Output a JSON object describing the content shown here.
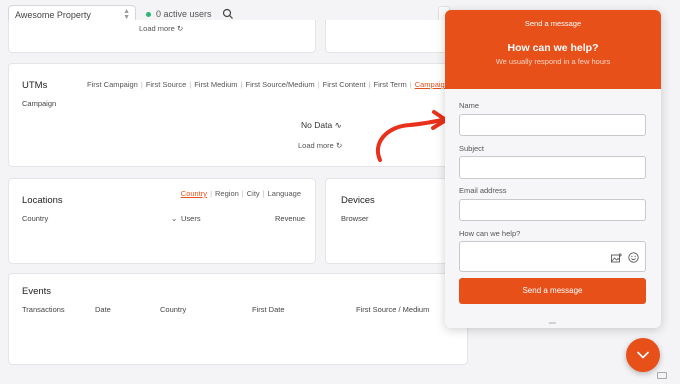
{
  "topbar": {
    "property": "Awesome Property",
    "active_users": "0 active users"
  },
  "top_card": {
    "load_more": "Load more"
  },
  "utms": {
    "title": "UTMs",
    "tabs": [
      "First Campaign",
      "First Source",
      "First Medium",
      "First Source/Medium",
      "First Content",
      "First Term",
      "Campaign"
    ],
    "column": "Campaign",
    "empty": "No Data",
    "load_more": "Load more"
  },
  "locations": {
    "title": "Locations",
    "tabs": [
      "Country",
      "Region",
      "City",
      "Language"
    ],
    "columns": [
      "Country",
      "Users",
      "Revenue"
    ]
  },
  "devices": {
    "title": "Devices",
    "column": "Browser"
  },
  "events": {
    "title": "Events",
    "columns": [
      "Transactions",
      "Date",
      "Country",
      "First Date",
      "First Source / Medium"
    ]
  },
  "chat": {
    "header": "Send a message",
    "heading": "How can we help?",
    "subheading": "We usually respond in a few hours",
    "fields": {
      "name": "Name",
      "subject": "Subject",
      "email": "Email address",
      "message": "How can we help?"
    },
    "submit": "Send a message",
    "accent": "#e8501a"
  }
}
